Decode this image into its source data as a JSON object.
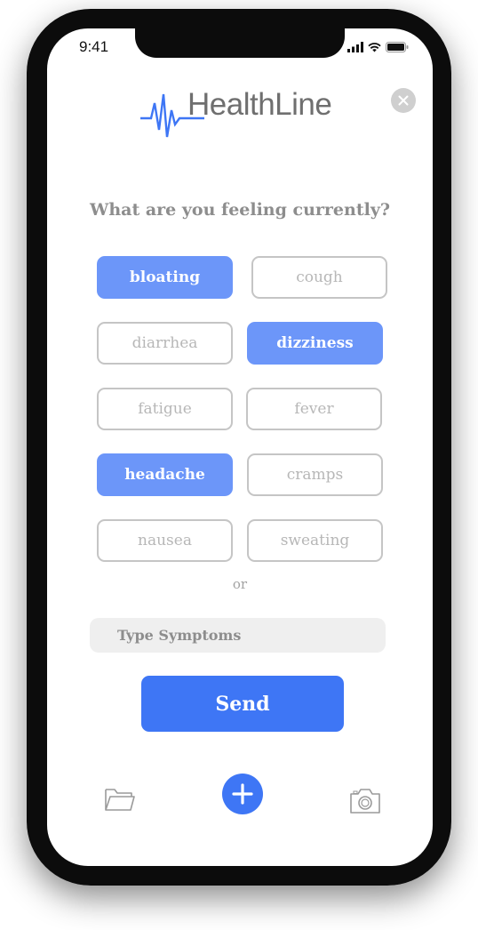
{
  "status_bar": {
    "time": "9:41",
    "icons": [
      "signal-icon",
      "wifi-icon",
      "battery-icon"
    ]
  },
  "header": {
    "logo_text": "HealthLine",
    "logo_icon": "heartbeat-pulse-icon",
    "close_icon": "close-icon"
  },
  "question": "What are you feeling currently?",
  "symptoms": [
    {
      "label": "bloating",
      "selected": true
    },
    {
      "label": "cough",
      "selected": false
    },
    {
      "label": "diarrhea",
      "selected": false
    },
    {
      "label": "dizziness",
      "selected": true
    },
    {
      "label": "fatigue",
      "selected": false
    },
    {
      "label": "fever",
      "selected": false
    },
    {
      "label": "headache",
      "selected": true
    },
    {
      "label": "cramps",
      "selected": false
    },
    {
      "label": "nausea",
      "selected": false
    },
    {
      "label": "sweating",
      "selected": false
    }
  ],
  "or_text": "or",
  "symptom_input": {
    "placeholder": "Type Symptoms",
    "value": ""
  },
  "send_label": "Send",
  "tab_bar": {
    "items": [
      "folder-icon",
      "add-icon",
      "camera-icon"
    ]
  },
  "colors": {
    "accent": "#3e76f5",
    "chip_selected": "#6c96f9",
    "chip_border": "#c5c5c5",
    "muted_text": "#8d8d8d",
    "input_bg": "#efefef"
  }
}
